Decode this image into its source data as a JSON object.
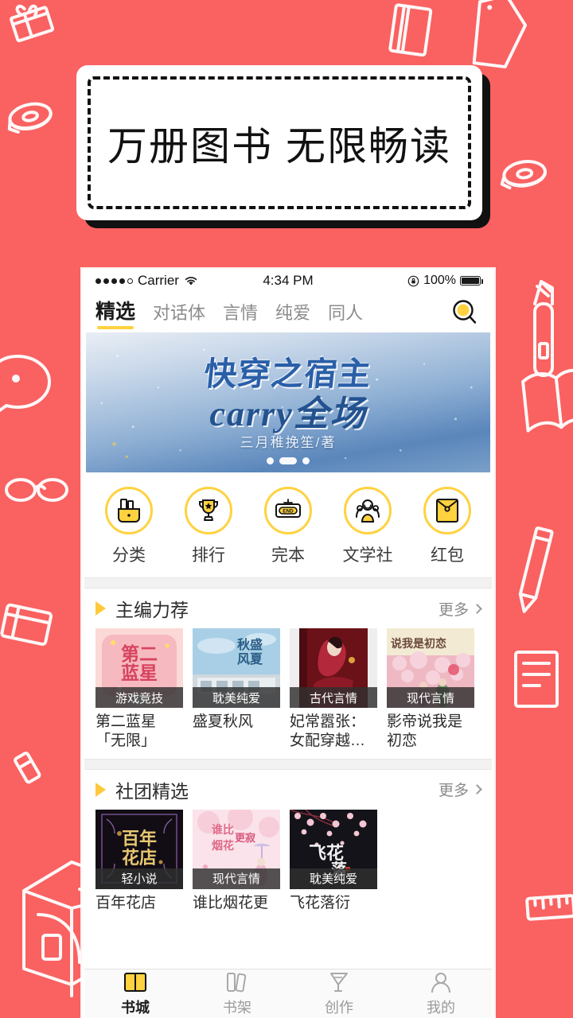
{
  "background": {
    "color": "#fa6161",
    "doodle_color": "#ffffff",
    "doodles": [
      "gift-box",
      "tape-roll",
      "tape-dispenser",
      "utility-knife",
      "eraser",
      "file-holder",
      "notebook",
      "glasses",
      "ruler",
      "pencil",
      "book",
      "speech-bubble",
      "clip",
      "paper-stack"
    ]
  },
  "promo": {
    "headline": "万册图书  无限畅读",
    "box_color": "#ffffff",
    "shadow_color": "#111111"
  },
  "phone": {
    "status_bar": {
      "carrier": "Carrier",
      "time": "4:34 PM",
      "battery_percent": "100%",
      "signal_dots_filled": 4,
      "signal_dots_total": 5,
      "wifi_icon": "wifi-icon",
      "lock_icon": "rotation-lock-icon"
    },
    "tabs": {
      "items": [
        {
          "label": "精选",
          "active": true
        },
        {
          "label": "对话体",
          "active": false
        },
        {
          "label": "言情",
          "active": false
        },
        {
          "label": "纯爱",
          "active": false
        },
        {
          "label": "同人",
          "active": false
        }
      ],
      "active_underline_color": "#ffd23f",
      "search_icon": "search-icon"
    },
    "banner": {
      "title": "快穿之宿主",
      "subtitle": "carry全场",
      "author": "三月稚挽笙/著",
      "dots_total": 3,
      "dots_active_index": 1
    },
    "quick_actions": [
      {
        "label": "分类",
        "icon": "category-bag-icon"
      },
      {
        "label": "排行",
        "icon": "trophy-icon"
      },
      {
        "label": "完本",
        "icon": "end-sign-icon"
      },
      {
        "label": "文学社",
        "icon": "community-people-icon"
      },
      {
        "label": "红包",
        "icon": "red-envelope-icon"
      }
    ],
    "sections": [
      {
        "title": "主编力荐",
        "more_label": "更多",
        "books": [
          {
            "title": "第二蓝星「无限」",
            "tag": "游戏竞技",
            "cover": "pink-floral"
          },
          {
            "title": "盛夏秋风",
            "tag": "耽美纯爱",
            "cover": "blue-sky-building"
          },
          {
            "title": "妃常嚣张：女配穿越…",
            "tag": "古代言情",
            "cover": "dark-red-hanfu"
          },
          {
            "title": "影帝说我是初恋",
            "tag": "现代言情",
            "cover": "cream-sakura"
          }
        ]
      },
      {
        "title": "社团精选",
        "more_label": "更多",
        "books": [
          {
            "title": "百年花店",
            "tag": "轻小说",
            "cover": "black-gold-frame"
          },
          {
            "title": "谁比烟花更",
            "tag": "现代言情",
            "cover": "pink-umbrella"
          },
          {
            "title": "飞花落衍",
            "tag": "耽美纯爱",
            "cover": "black-sakura"
          }
        ]
      }
    ],
    "bottom_nav": [
      {
        "label": "书城",
        "icon": "open-book-icon",
        "active": true
      },
      {
        "label": "书架",
        "icon": "bookshelf-icon",
        "active": false
      },
      {
        "label": "创作",
        "icon": "pen-nib-icon",
        "active": false
      },
      {
        "label": "我的",
        "icon": "person-icon",
        "active": false
      }
    ]
  }
}
